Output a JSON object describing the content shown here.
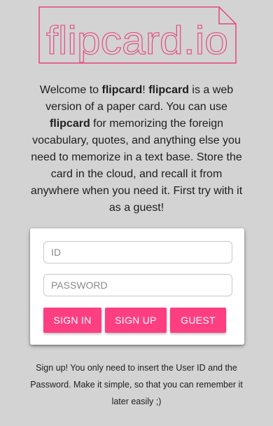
{
  "logo": {
    "text": "flipcard.io",
    "color": "#e5467e"
  },
  "intro": {
    "t1": "Welcome to ",
    "b1": "flipcard",
    "t2": "! ",
    "b2": "flipcard",
    "t3": " is a web version of a paper card. You can use ",
    "b3": "flipcard",
    "t4": " for memorizing the foreign vocabulary, quotes, and anything else you need to memorize in a text base. Store the card in the cloud, and recall it from anywhere when you need it. First try with it as a guest!"
  },
  "login": {
    "id_placeholder": "ID",
    "id_value": "",
    "password_placeholder": "PASSWORD",
    "password_value": "",
    "signin_label": "SIGN IN",
    "signup_label": "SIGN UP",
    "guest_label": "GUEST",
    "accent_color": "#fd3f82"
  },
  "note": "Sign up! You only need to insert the User ID and the Password. Make it simple, so that you can remember it later easily ;)"
}
